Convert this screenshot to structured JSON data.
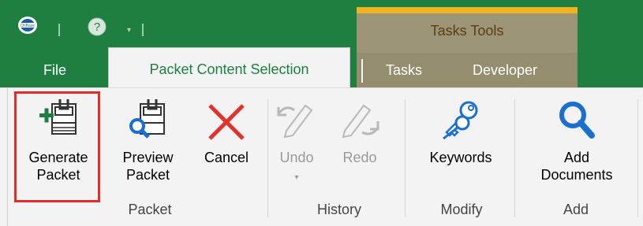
{
  "qat": {
    "help_glyph": "?",
    "dropdown_glyph": "▾"
  },
  "contextual": {
    "label": "Tasks Tools"
  },
  "tabs": {
    "file": "File",
    "active": "Packet Content Selection",
    "tasks": "Tasks",
    "developer": "Developer"
  },
  "buttons": {
    "generate": "Generate\nPacket",
    "preview": "Preview\nPacket",
    "cancel": "Cancel",
    "undo": "Undo",
    "redo": "Redo",
    "keywords": "Keywords",
    "add_documents": "Add\nDocuments"
  },
  "groups": {
    "packet": "Packet",
    "history": "History",
    "modify": "Modify",
    "add": "Add"
  },
  "colors": {
    "accent_green": "#1e7f41",
    "highlight_red": "#e22b2b",
    "context_gold": "#f2b31d",
    "cancel_red": "#e3322b",
    "icon_blue": "#1a6fd1"
  },
  "icons": [
    "onbase-logo-icon",
    "help-icon",
    "quick-access-dropdown-icon",
    "generate-packet-icon",
    "preview-packet-icon",
    "cancel-x-icon",
    "undo-icon",
    "redo-icon",
    "keywords-icon",
    "add-documents-icon"
  ]
}
